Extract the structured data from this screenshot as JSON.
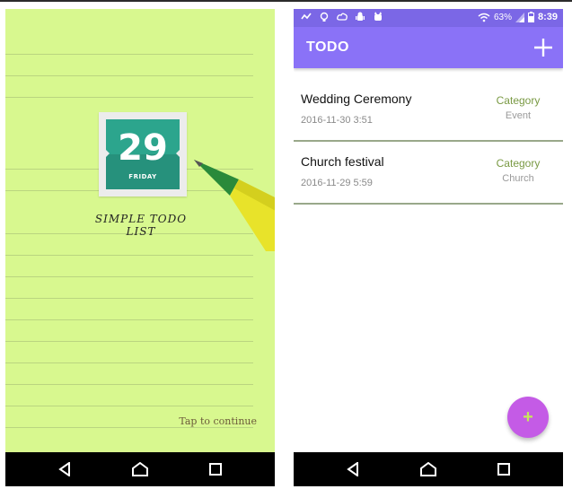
{
  "splash": {
    "calendar_day_number": "29",
    "calendar_weekday": "FRIDAY",
    "app_title": "SIMPLE TODO LIST",
    "tap_hint": "Tap to continue",
    "background_color": "#d8f88f"
  },
  "status_bar": {
    "battery_percent": "63%",
    "time": "8:39",
    "icons": [
      "signal-check-icon",
      "lightbulb-icon",
      "cloud-sync-icon",
      "android-icon",
      "cat-icon",
      "wifi-icon",
      "cell-signal-icon",
      "battery-icon"
    ]
  },
  "app_bar": {
    "title": "TODO",
    "color": "#8a72f7",
    "add_icon": "plus-icon"
  },
  "todos": [
    {
      "title": "Wedding Ceremony",
      "date": "2016-11-30 3:51",
      "category_label": "Category",
      "category": "Event"
    },
    {
      "title": "Church festival",
      "date": "2016-11-29 5:59",
      "category_label": "Category",
      "category": "Church"
    }
  ],
  "fab": {
    "icon": "plus-icon",
    "label": "+",
    "color": "#c45be6"
  },
  "nav_bar": {
    "icons": [
      "back-icon",
      "home-icon",
      "recents-icon"
    ]
  }
}
